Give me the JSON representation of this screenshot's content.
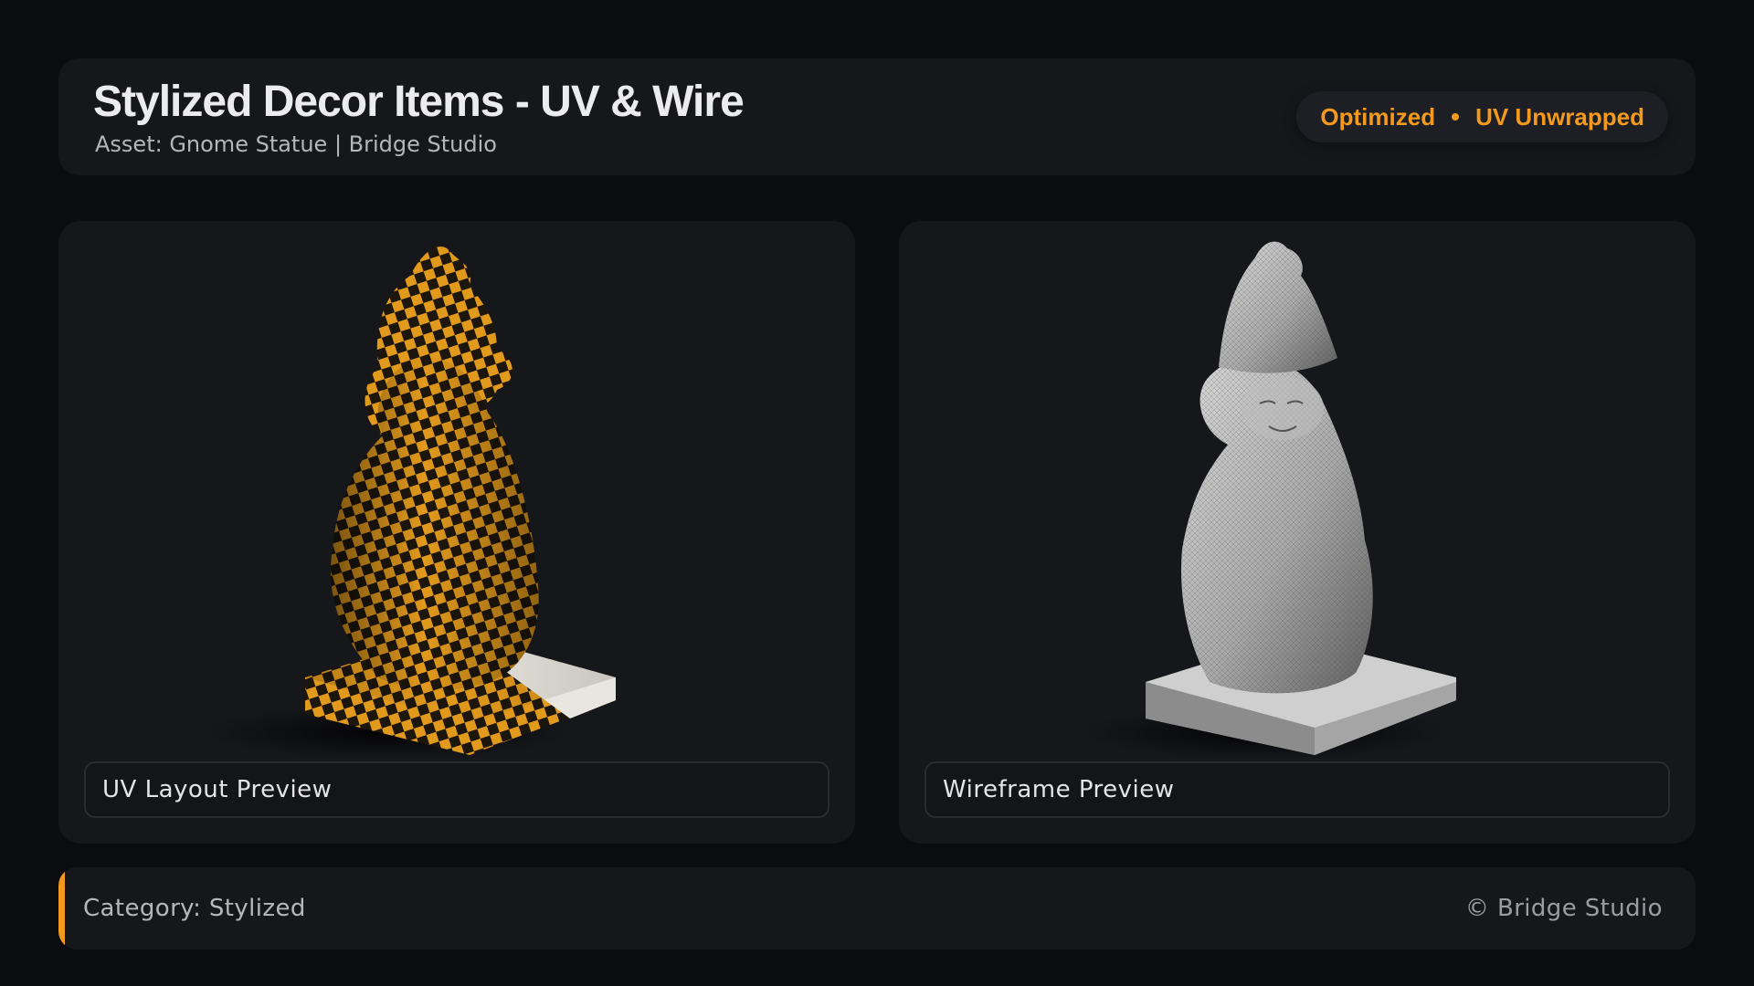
{
  "header": {
    "title": "Stylized Decor Items - UV & Wire",
    "subtitle": "Asset: Gnome Statue | Bridge Studio",
    "badges": {
      "first": "Optimized",
      "second": "UV Unwrapped"
    }
  },
  "panels": {
    "uv": {
      "caption": "UV Layout Preview",
      "image": "gnome-statue-uv-checker"
    },
    "wire": {
      "caption": "Wireframe Preview",
      "image": "gnome-statue-wireframe"
    }
  },
  "footer": {
    "category": "Category: Stylized",
    "copyright": "© Bridge Studio"
  },
  "colors": {
    "accent": "#f39a1e",
    "background": "#0b0c0f",
    "panel": "#16171b"
  }
}
